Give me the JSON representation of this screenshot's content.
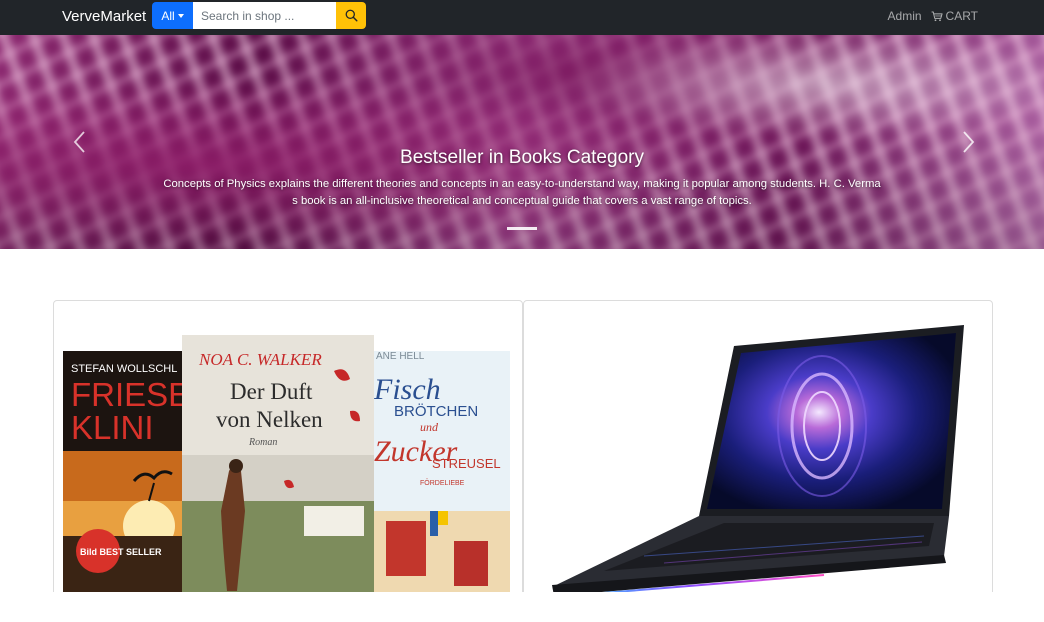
{
  "navbar": {
    "brand": "VerveMarket",
    "category_label": "All",
    "search_placeholder": "Search in shop ...",
    "admin_label": "Admin",
    "cart_label": "CART",
    "colors": {
      "background": "#212529",
      "category_button": "#0d6efd",
      "search_button": "#ffc107"
    },
    "icons": {
      "search": "search-icon",
      "cart": "cart-icon",
      "dropdown": "caret-down-icon"
    }
  },
  "carousel": {
    "title": "Bestseller in Books Category",
    "text": "Concepts of Physics explains the different theories and concepts in an easy-to-understand way, making it popular among students. H. C. Verma s book is an all-inclusive theoretical and conceptual guide that covers a vast range of topics.",
    "prev_icon": "chevron-left-icon",
    "next_icon": "chevron-right-icon",
    "slide_count": 1,
    "active_slide": 1
  },
  "products": [
    {
      "name": "books-product",
      "books": [
        {
          "author": "STEFAN WOLLSCHL",
          "title_lines": [
            "FRIESE",
            "KLINI"
          ],
          "badge": "Bild BEST SELLER"
        },
        {
          "author": "NOA C. WALKER",
          "title_lines": [
            "Der Duft",
            "von Nelken"
          ],
          "subtitle": "Roman"
        },
        {
          "author": "ANE HELL",
          "title_lines": [
            "Fisch",
            "BRÖTCHEN",
            "und",
            "Zucker",
            "STREUSEL"
          ],
          "subtitle": "FÖRDELIEBE"
        }
      ]
    },
    {
      "name": "laptop-product"
    }
  ]
}
